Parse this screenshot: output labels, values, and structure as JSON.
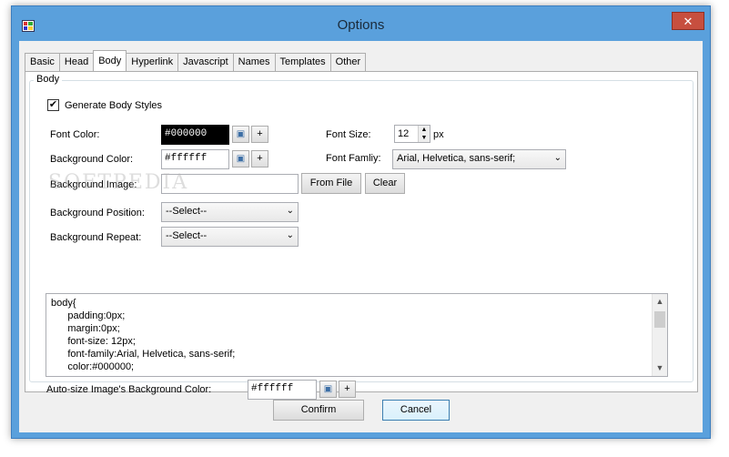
{
  "window": {
    "title": "Options",
    "close_glyph": "✕"
  },
  "tabs": [
    {
      "label": "Basic"
    },
    {
      "label": "Head"
    },
    {
      "label": "Body",
      "active": true
    },
    {
      "label": "Hyperlink"
    },
    {
      "label": "Javascript"
    },
    {
      "label": "Names"
    },
    {
      "label": "Templates"
    },
    {
      "label": "Other"
    }
  ],
  "group": {
    "title": "Body"
  },
  "generate": {
    "label": "Generate Body Styles",
    "checked": true,
    "mark": "✔"
  },
  "font_color": {
    "label": "Font Color:",
    "value": "#000000"
  },
  "background_color": {
    "label": "Background Color:",
    "value": "#ffffff"
  },
  "background_image": {
    "label": "Background Image:",
    "value": "",
    "from_file": "From File",
    "clear": "Clear"
  },
  "background_position": {
    "label": "Background Position:",
    "value": "--Select--"
  },
  "background_repeat": {
    "label": "Background Repeat:",
    "value": "--Select--"
  },
  "font_size": {
    "label": "Font Size:",
    "value": "12",
    "unit": "px"
  },
  "font_family": {
    "label": "Font Famliy:",
    "value": "Arial, Helvetica, sans-serif;"
  },
  "css_preview": {
    "lines": [
      "body{",
      "      padding:0px;",
      "      margin:0px;",
      "      font-size: 12px;",
      "      font-family:Arial, Helvetica, sans-serif;",
      "      color:#000000;"
    ]
  },
  "autosize": {
    "label": "Auto-size Image's Background Color:",
    "value": "#ffffff"
  },
  "picker_glyph": "▣",
  "plus_glyph": "+",
  "chevron_glyph": "⌄",
  "spin_up": "▲",
  "spin_down": "▼",
  "scroll_up": "▲",
  "scroll_down": "▼",
  "buttons": {
    "confirm": "Confirm",
    "cancel": "Cancel"
  },
  "watermark": "SOFTPEDIA",
  "colors": {
    "title_bar": "#5aa0dc",
    "close": "#c74f3f"
  }
}
